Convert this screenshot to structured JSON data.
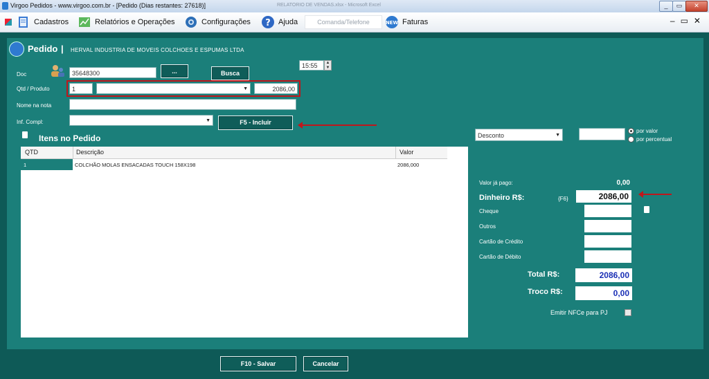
{
  "window": {
    "title": "Virgoo Pedidos - www.virgoo.com.br - [Pedido (Dias restantes: 27618)]",
    "background_title": "RELATORIO DE VENDAS.xlsx - Microsoft Excel"
  },
  "menu": {
    "items": [
      {
        "label": "Cadastros",
        "icon": "cadastros-icon"
      },
      {
        "label": "Relatórios e Operações",
        "icon": "chart-icon"
      },
      {
        "label": "Configurações",
        "icon": "gear-icon"
      },
      {
        "label": "Ajuda",
        "icon": "help-icon"
      }
    ],
    "comanda_placeholder": "Comanda/Telefone",
    "faturas_label": "Faturas"
  },
  "pedido": {
    "title": "Pedido",
    "company": "HERVAL INDUSTRIA DE MOVEIS COLCHOES E ESPUMAS LTDA",
    "time": "15:55",
    "doc_label": "Doc",
    "doc_value": "35648300",
    "doc_more_label": "...",
    "busca_label": "Busca",
    "qtd_label": "Qtd / Produto",
    "qtd_value": "1",
    "produto_value": "",
    "preco_value": "2086,00",
    "nome_label": "Nome na nota",
    "nome_value": "",
    "inf_label": "Inf. Compl:",
    "inf_value": "",
    "incluir_label": "F5 - Incluir"
  },
  "items_section": {
    "title": "Itens no Pedido",
    "columns": [
      "QTD",
      "Descrição",
      "Valor"
    ],
    "rows": [
      {
        "qtd": "1",
        "descricao": "COLCHÃO MOLAS ENSACADAS TOUCH 158X198",
        "valor": "2086,000"
      }
    ]
  },
  "payment": {
    "desconto_label": "Desconto",
    "desconto_value": "",
    "por_valor": "por valor",
    "por_percentual": "por percentual",
    "valor_ja_pago_label": "Valor já pago:",
    "valor_ja_pago": "0,00",
    "dinheiro_label": "Dinheiro R$:",
    "dinheiro_hotkey": "{F6}",
    "dinheiro_value": "2086,00",
    "cheque_label": "Cheque",
    "outros_label": "Outros",
    "credito_label": "Cartão de Crédito",
    "debito_label": "Cartão de Débito",
    "total_label": "Total  R$:",
    "total_value": "2086,00",
    "troco_label": "Troco R$:",
    "troco_value": "0,00",
    "nfce_label": "Emitir NFCe para PJ"
  },
  "footer": {
    "salvar_label": "F10 - Salvar",
    "cancelar_label": "Cancelar"
  },
  "colors": {
    "panel": "#1b7f7a",
    "outer": "#0e5a57",
    "highlight": "#c0161b",
    "money_blue": "#1a2fb5"
  }
}
